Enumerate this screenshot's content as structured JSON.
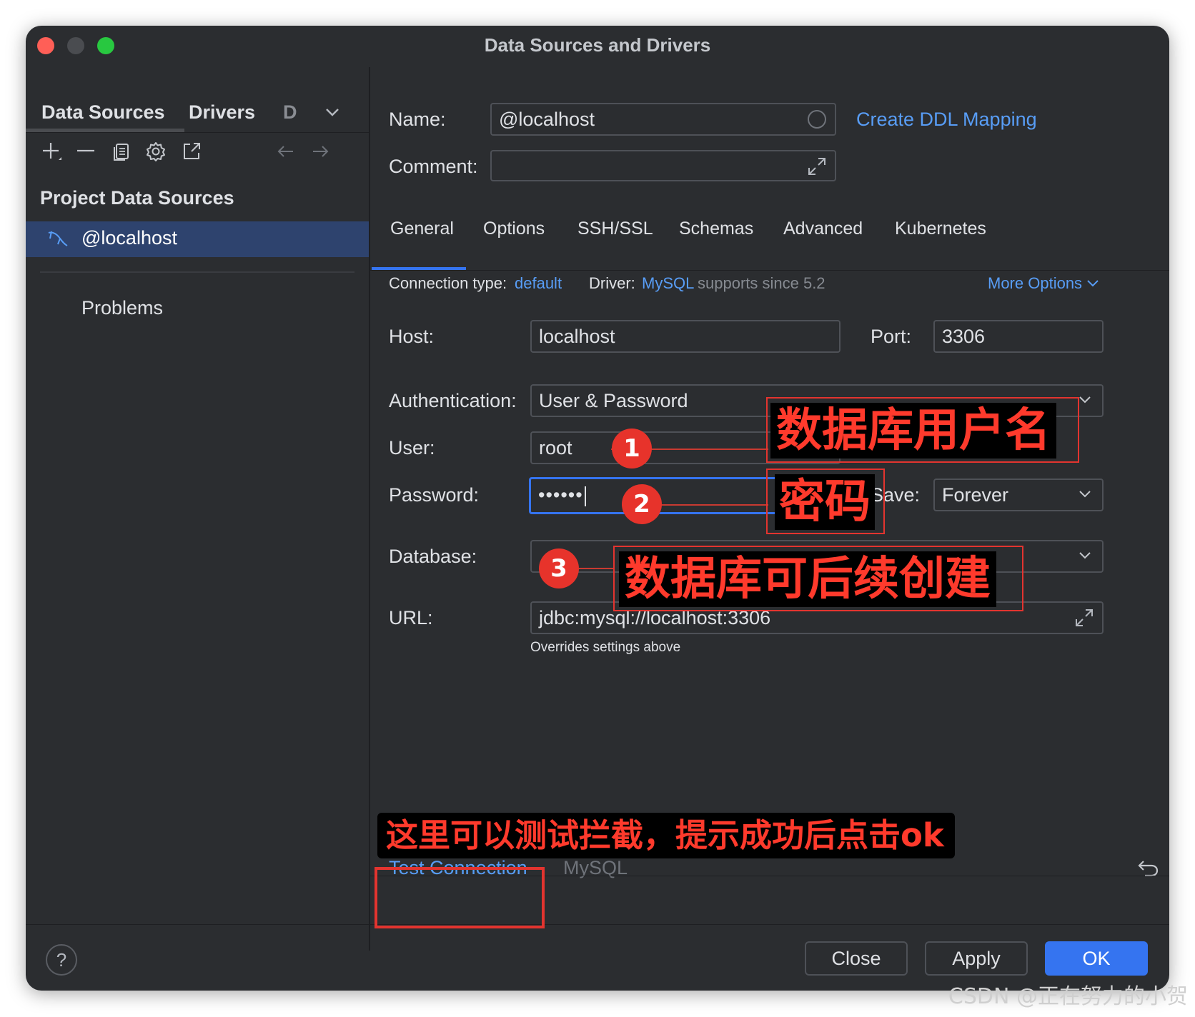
{
  "window": {
    "title": "Data Sources and Drivers"
  },
  "left": {
    "tabs": [
      "Data Sources",
      "Drivers",
      "D"
    ],
    "section_title": "Project Data Sources",
    "selected_item": "@localhost",
    "problems": "Problems"
  },
  "right": {
    "name_label": "Name:",
    "name_value": "@localhost",
    "comment_label": "Comment:",
    "create_ddl": "Create DDL Mapping",
    "tabs": [
      "General",
      "Options",
      "SSH/SSL",
      "Schemas",
      "Advanced",
      "Kubernetes"
    ],
    "conn_type_label": "Connection type:",
    "conn_type_value": "default",
    "driver_label": "Driver:",
    "driver_value": "MySQL",
    "driver_note": "supports since 5.2",
    "more_options": "More Options",
    "host_label": "Host:",
    "host_value": "localhost",
    "port_label": "Port:",
    "port_value": "3306",
    "auth_label": "Authentication:",
    "auth_value": "User & Password",
    "user_label": "User:",
    "user_value": "root",
    "password_label": "Password:",
    "password_value": "••••••",
    "save_label": "Save:",
    "save_value": "Forever",
    "database_label": "Database:",
    "url_label": "URL:",
    "url_value": "jdbc:mysql://localhost:3306",
    "url_note": "Overrides settings above"
  },
  "bottom": {
    "test_connection": "Test Connection",
    "driver_name": "MySQL"
  },
  "footer": {
    "help": "?",
    "close": "Close",
    "apply": "Apply",
    "ok": "OK"
  },
  "annotations": {
    "user_note": "数据库用户名",
    "password_note": "密码",
    "database_note": "数据库可后续创建",
    "test_note": "这里可以测试拦截，提示成功后点击ok",
    "n1": "1",
    "n2": "2",
    "n3": "3"
  },
  "watermark": "CSDN @正在努力的小贺",
  "colors": {
    "accent": "#3574f0",
    "link": "#589df6",
    "annotation": "#ff3a2c",
    "background": "#2b2d30"
  }
}
